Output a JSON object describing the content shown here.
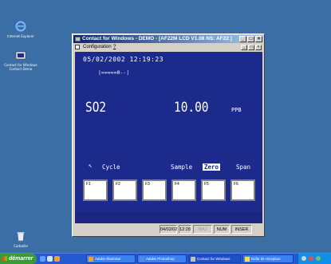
{
  "desktop": {
    "icons": [
      {
        "label": "Internet Explorer",
        "icon": "internet-explorer-icon"
      },
      {
        "label": "Contact for Windows Contact Demo",
        "icon": "contact-app-icon"
      },
      {
        "label": "Corbeille",
        "icon": "recycle-bin-icon"
      }
    ]
  },
  "window": {
    "title": "Contact for Windows - DEMO - [AF22M LCD  V1.08 NS: AF22 ]",
    "menu": [
      "Configuration",
      "?"
    ]
  },
  "lcd": {
    "datetime": "05/02/2002 12:19:23",
    "bargraph": "|=====0--|",
    "gas": "SO2",
    "reading": "10.00",
    "unit": "PPB",
    "cursor": "↖",
    "functions": [
      {
        "label": "Cycle",
        "highlighted": false
      },
      {
        "label": "Sample",
        "highlighted": false
      },
      {
        "label": "Zero",
        "highlighted": true
      },
      {
        "label": "Span",
        "highlighted": false
      }
    ],
    "fkeys": [
      "F1",
      "F2",
      "F3",
      "F4",
      "F5",
      "F6"
    ],
    "colors": {
      "background": "#1c2a8c",
      "text": "#ffffff"
    }
  },
  "statusbar": {
    "date": "04/02/02",
    "time": "12:28",
    "maj": "MAJ",
    "num": "NUM",
    "inser": "INSER"
  },
  "taskbar": {
    "start_label": "démarrer",
    "buttons": [
      "Adobe Illustrator",
      "Adobe Photoshop",
      "Contact for Windows",
      "Boîte de réception"
    ]
  }
}
